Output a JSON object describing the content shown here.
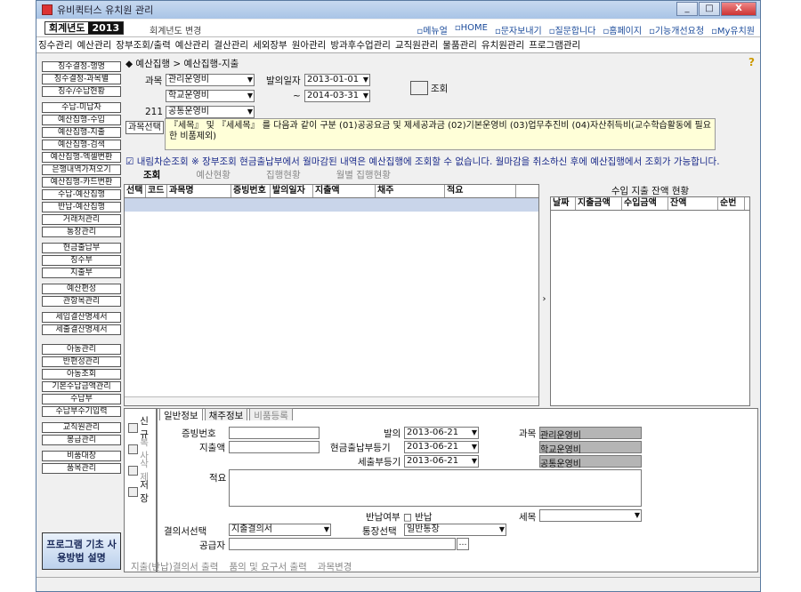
{
  "window": {
    "title": "유비퀵터스 유치원 관리"
  },
  "top": {
    "year_label": "회계년도",
    "year": "2013",
    "year_change": "회계년도 변경",
    "links": [
      "메뉴얼",
      "HOME",
      "문자보내기",
      "질문합니다",
      "홈페이지",
      "기능개선요청",
      "My유치원"
    ]
  },
  "menu": [
    "징수관리",
    "예산관리",
    "장부조회/출력",
    "예산관리",
    "결산관리",
    "세외장부",
    "원아관리",
    "방과후수업관리",
    "교직원관리",
    "물품관리",
    "유치원관리",
    "프로그램관리"
  ],
  "sidebar": [
    "징수결정-행명",
    "징수결정-과목별",
    "징수/수납현황",
    "수납-미납자",
    "예산집행-수입",
    "예산집행-지출",
    "예산집행-검색",
    "예산집행-엑셀변환",
    "은행내역가져오기",
    "예산집행-카드변환",
    "수납-예산집행",
    "반납-예산집행",
    "거래처관리",
    "통장관리",
    "현금출납부",
    "징수부",
    "지출부",
    "예산편성",
    "관항목관리",
    "세입결산명세서",
    "세출결산명세서",
    "아동관리",
    "반편성관리",
    "아동조회",
    "기본수납금액관리",
    "수납부",
    "수납부수기입력",
    "교직원관리",
    "봉급관리",
    "비품대장",
    "품목관리"
  ],
  "help": "프로그램 기초 사용방법 설명",
  "crumb": "◆ 예산집행 > 예산집행-지출",
  "filter": {
    "subject_label": "과목",
    "subject1": "관리운영비",
    "subject2": "학교운영비",
    "code": "211",
    "subject3": "공통운영비",
    "date_label": "발의일자",
    "date_from": "2013-01-01",
    "date_to": "2014-03-31",
    "tilde": "~",
    "search": "조회",
    "select_subject": "과목선택"
  },
  "note": "『세목』 및 『세세목』 를 다음과 같이 구분 (01)공공요금 및 제세공과금 (02)기본운영비 (03)업무추진비 (04)자산취득비(교수학습활동에 필요한 비품제외)",
  "warn": "☑ 내림차순조회 ※ 장부조회 현금출납부에서 월마감된 내역은 예산집행에 조회할 수 없습니다. 월마감을 취소하신 후에 예산집행에서 조회가 가능합니다.",
  "tabs": [
    "조회",
    "예산현황",
    "집행현황",
    "월별 집행현황"
  ],
  "grid1_cols": [
    "선택",
    "코드",
    "과목명",
    "증빙번호",
    "발의일자",
    "지출액",
    "채주",
    "적요"
  ],
  "grid2": {
    "title": "수입 지출 잔액 현황",
    "cols": [
      "날짜",
      "지출금액",
      "수입금액",
      "잔액",
      "순번"
    ]
  },
  "tools": [
    "신규",
    "복사",
    "삭제",
    "저장"
  ],
  "btabs": [
    "일반정보",
    "채주정보",
    "비품등록"
  ],
  "form": {
    "voucher": "증빙번호",
    "expense": "지출액",
    "issue": "발의",
    "issue_date": "2013-06-21",
    "cash": "현금출납부등기",
    "cash_date": "2013-06-21",
    "tax": "세출부등기",
    "tax_date": "2013-06-21",
    "subject": "과목",
    "s1": "관리운영비",
    "s2": "학교운영비",
    "s3": "공통운영비",
    "memo": "적요",
    "refund": "반납여부 □ 반납",
    "semok": "세목",
    "resol": "결의서선택",
    "resol_val": "지출결의서",
    "bank": "통장선택",
    "bank_val": "일반통장",
    "supplier": "공급자"
  },
  "footer": [
    "지출(반납)결의서 출력",
    "품의 및 요구서 출력",
    "과목변경"
  ]
}
